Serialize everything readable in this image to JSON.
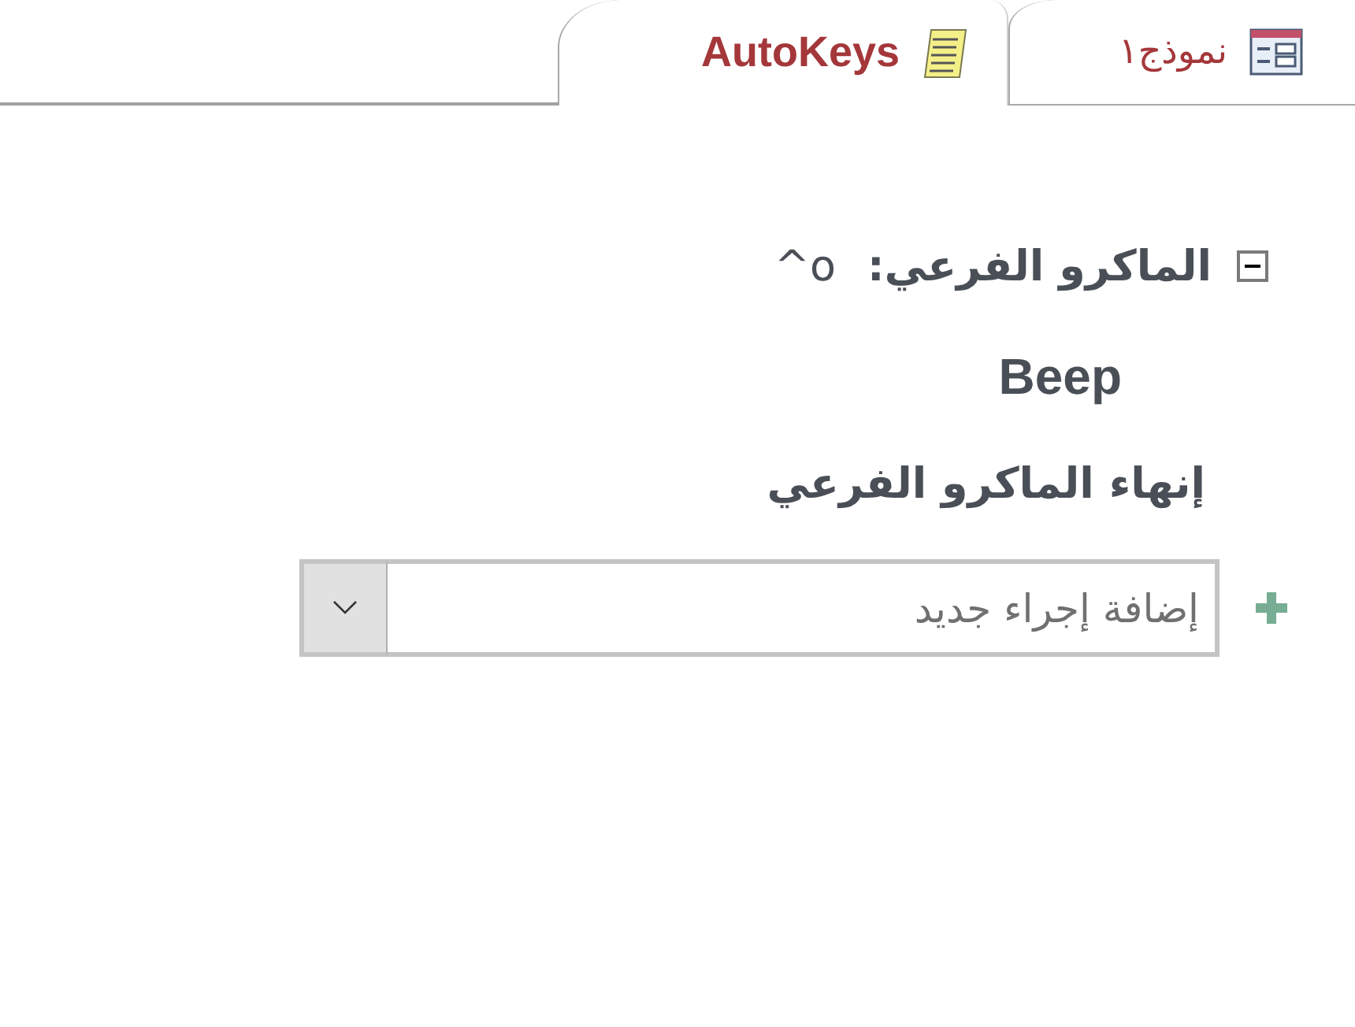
{
  "tabs": [
    {
      "label": "نموذج١",
      "kind": "form",
      "selected": false
    },
    {
      "label": "AutoKeys",
      "kind": "macro",
      "selected": true
    }
  ],
  "submacro": {
    "label": "الماكرو الفرعي:",
    "name": "^o",
    "expanded": true,
    "actions": [
      "Beep",
      "إنهاء الماكرو الفرعي"
    ]
  },
  "new_action": {
    "placeholder": "إضافة إجراء جديد"
  }
}
